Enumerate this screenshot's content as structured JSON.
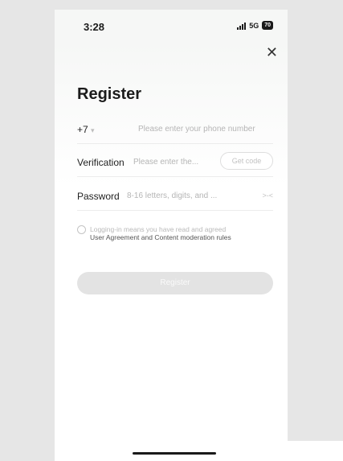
{
  "status_bar": {
    "time": "3:28",
    "network": "5G",
    "battery": "70"
  },
  "header": {
    "title": "Register"
  },
  "phone_row": {
    "country_code": "+7",
    "placeholder": "Please enter your phone number"
  },
  "verification_row": {
    "label": "Verification",
    "placeholder": "Please enter the...",
    "get_code_label": "Get code"
  },
  "password_row": {
    "label": "Password",
    "placeholder": "8-16 letters, digits, and ...",
    "toggle_glyph": ">-<"
  },
  "agreement": {
    "prefix": "Logging-in means you have read and agreed",
    "links": "User Agreement and Content moderation rules"
  },
  "register_button": {
    "label": "Register"
  }
}
